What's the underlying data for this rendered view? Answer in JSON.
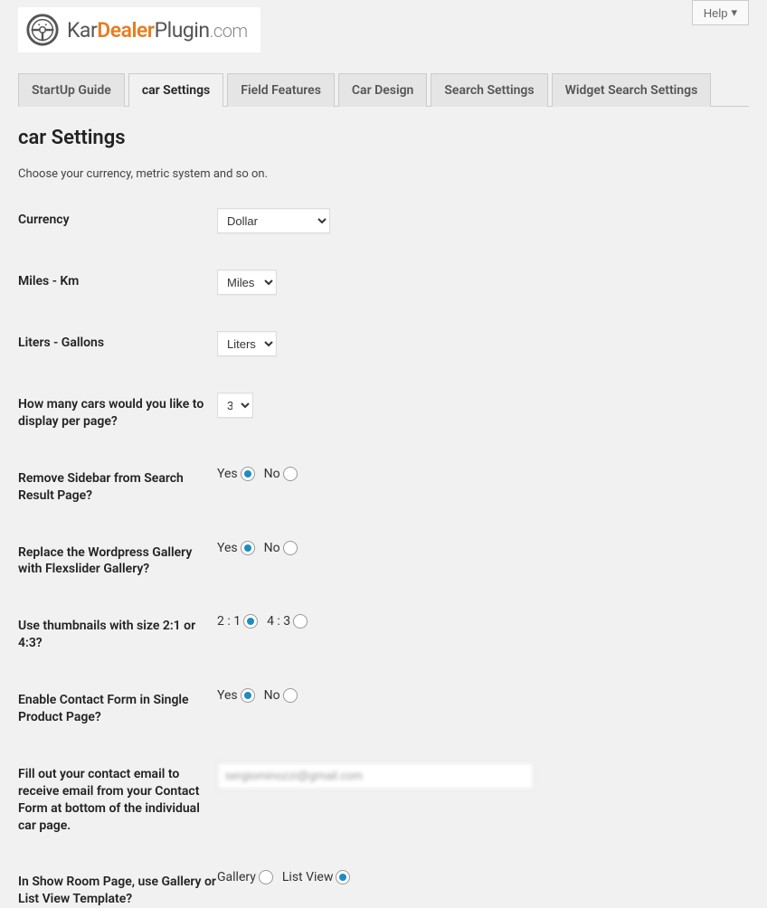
{
  "header": {
    "logo_kar": "Kar",
    "logo_dealer": "Dealer",
    "logo_plugin": "Plugin",
    "logo_com": ".com",
    "help_label": "Help"
  },
  "tabs": [
    {
      "label": "StartUp Guide"
    },
    {
      "label": "car Settings"
    },
    {
      "label": "Field Features"
    },
    {
      "label": "Car Design"
    },
    {
      "label": "Search Settings"
    },
    {
      "label": "Widget Search Settings"
    }
  ],
  "page": {
    "title": "car Settings",
    "description": "Choose your currency, metric system and so on."
  },
  "fields": {
    "currency": {
      "label": "Currency",
      "value": "Dollar"
    },
    "distance": {
      "label": "Miles - Km",
      "value": "Miles"
    },
    "volume": {
      "label": "Liters - Gallons",
      "value": "Liters"
    },
    "per_page": {
      "label": "How many cars would you like to display per page?",
      "value": "3"
    },
    "remove_sidebar": {
      "label": "Remove Sidebar from Search Result Page?",
      "yes": "Yes",
      "no": "No"
    },
    "flexslider": {
      "label": "Replace the Wordpress Gallery with Flexslider Gallery?",
      "yes": "Yes",
      "no": "No"
    },
    "thumbnails": {
      "label": "Use thumbnails with size 2:1 or 4:3?",
      "opt1": "2 : 1",
      "opt2": "4 : 3"
    },
    "contact_form": {
      "label": "Enable Contact Form in Single Product Page?",
      "yes": "Yes",
      "no": "No"
    },
    "contact_email": {
      "label": "Fill out your contact email to receive email from your Contact Form at bottom of the individual car page.",
      "value": "sergiominozzi@gmail.com"
    },
    "showroom": {
      "label": "In Show Room Page, use Gallery or List View Template?",
      "opt1": "Gallery",
      "opt2": "List View"
    }
  }
}
